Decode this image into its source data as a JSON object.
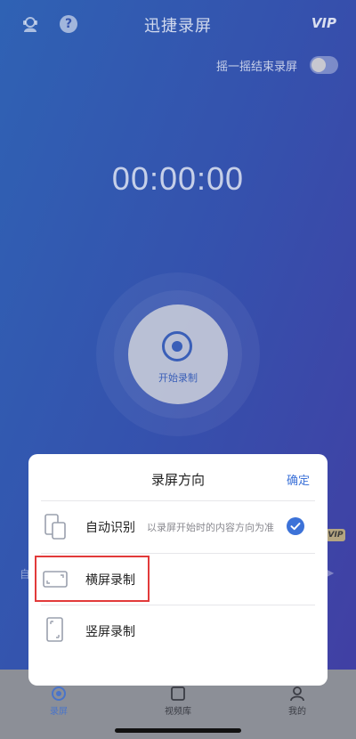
{
  "header": {
    "title": "迅捷录屏",
    "vip": "VIP",
    "service_icon": "headset-icon",
    "help_icon": "help-icon",
    "help_glyph": "?"
  },
  "shake": {
    "label": "摇一摇结束录屏",
    "enabled": false
  },
  "timer": "00:00:00",
  "record_button": {
    "label": "开始录制"
  },
  "background_peek": {
    "left_text": "自",
    "vip_badge": "VIP"
  },
  "sheet": {
    "title": "录屏方向",
    "confirm": "确定",
    "options": [
      {
        "label": "自动识别",
        "desc": "以录屏开始时的内容方向为准",
        "icon": "auto-rotate-icon",
        "selected": true
      },
      {
        "label": "横屏录制",
        "desc": "",
        "icon": "landscape-icon",
        "selected": false,
        "highlighted": true
      },
      {
        "label": "竖屏录制",
        "desc": "",
        "icon": "portrait-icon",
        "selected": false
      }
    ]
  },
  "tabs": [
    {
      "label": "录屏",
      "icon": "record-tab-icon",
      "active": true
    },
    {
      "label": "视频库",
      "icon": "video-library-icon",
      "active": false
    },
    {
      "label": "我的",
      "icon": "profile-icon",
      "active": false
    }
  ],
  "colors": {
    "accent": "#3c72d8",
    "highlight": "#e23a3a"
  }
}
